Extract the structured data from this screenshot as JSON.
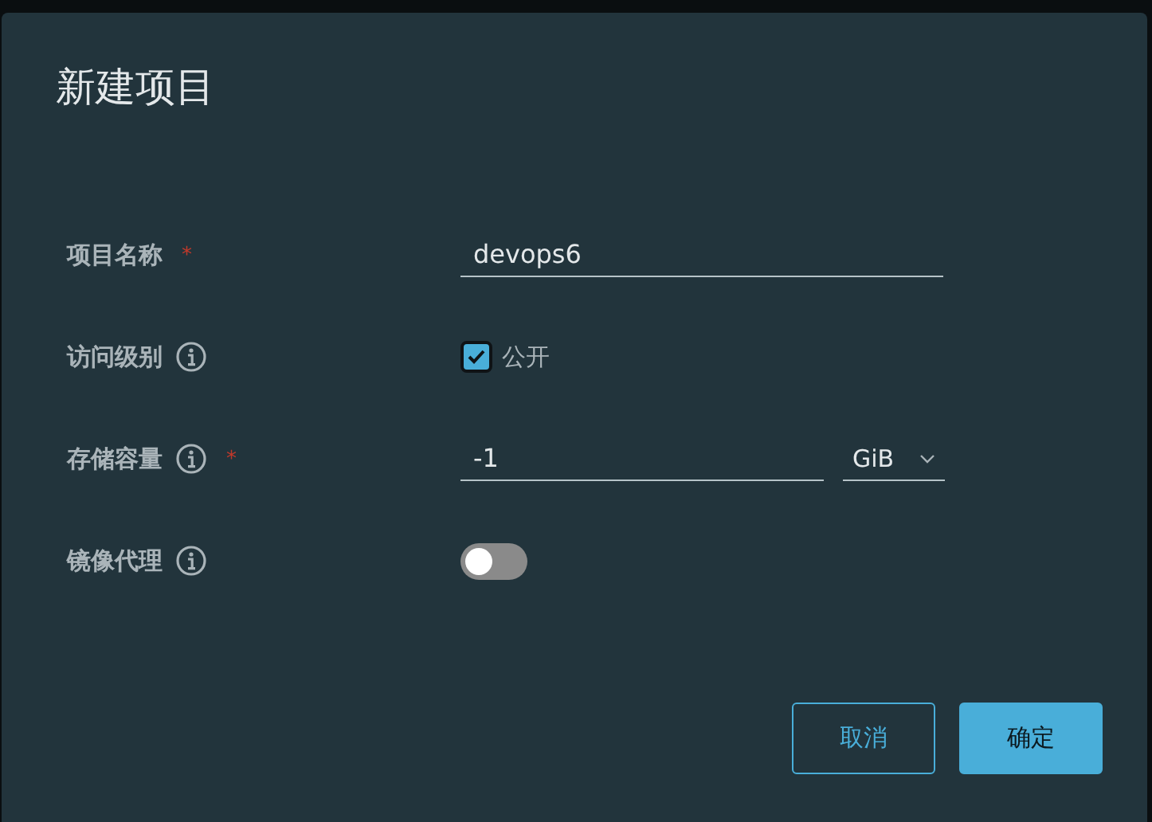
{
  "dialog": {
    "title": "新建项目"
  },
  "fields": [
    {
      "kind": "text",
      "label": "项目名称",
      "info": false,
      "required_mark": "*",
      "value": "devops6"
    },
    {
      "kind": "checkbox",
      "label": "访问级别",
      "info": true,
      "checked": true,
      "option": "公开"
    },
    {
      "kind": "unit",
      "label": "存储容量",
      "info": true,
      "required_mark": "*",
      "value": "-1",
      "unit": "GiB"
    },
    {
      "kind": "toggle",
      "label": "镜像代理",
      "info": true,
      "on": false
    }
  ],
  "buttons": [
    {
      "label": "取消",
      "primary": false
    },
    {
      "label": "确定",
      "primary": true
    }
  ]
}
